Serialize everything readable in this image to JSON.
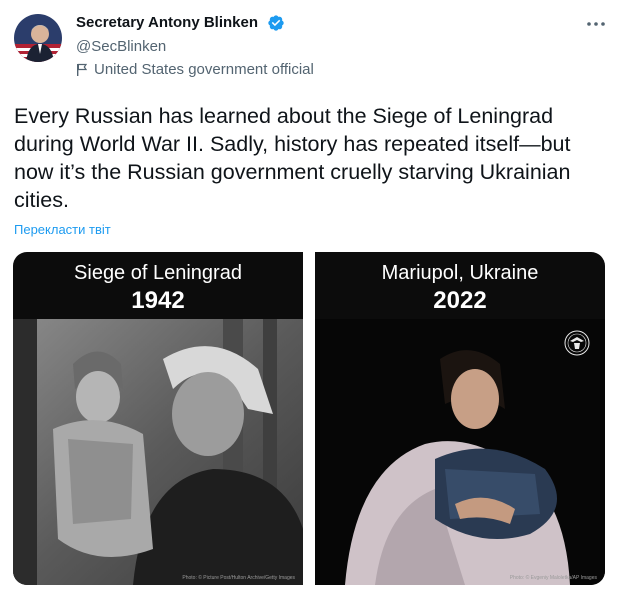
{
  "author": {
    "name": "Secretary Antony Blinken",
    "handle": "@SecBlinken",
    "label": "United States government official"
  },
  "tweet": {
    "text": "Every Russian has learned about the Siege of Leningrad during World War II. Sadly, history has repeated itself—but now it’s the Russian government cruelly starving Ukrainian cities.",
    "translate": "Перекласти твіт"
  },
  "media": [
    {
      "title": "Siege of Leningrad",
      "year": "1942",
      "credit": "Photo: © Picture Post/Hulton Archive/Getty Images"
    },
    {
      "title": "Mariupol, Ukraine",
      "year": "2022",
      "credit": "Photo: © Evgeniy Maloletka/AP Images"
    }
  ],
  "colors": {
    "link": "#1d9bf0",
    "muted": "#536471",
    "verified": "#1d9bf0"
  },
  "icons": [
    "avatar",
    "verified-badge-icon",
    "flag-icon",
    "more-options-icon",
    "state-department-seal-icon"
  ]
}
